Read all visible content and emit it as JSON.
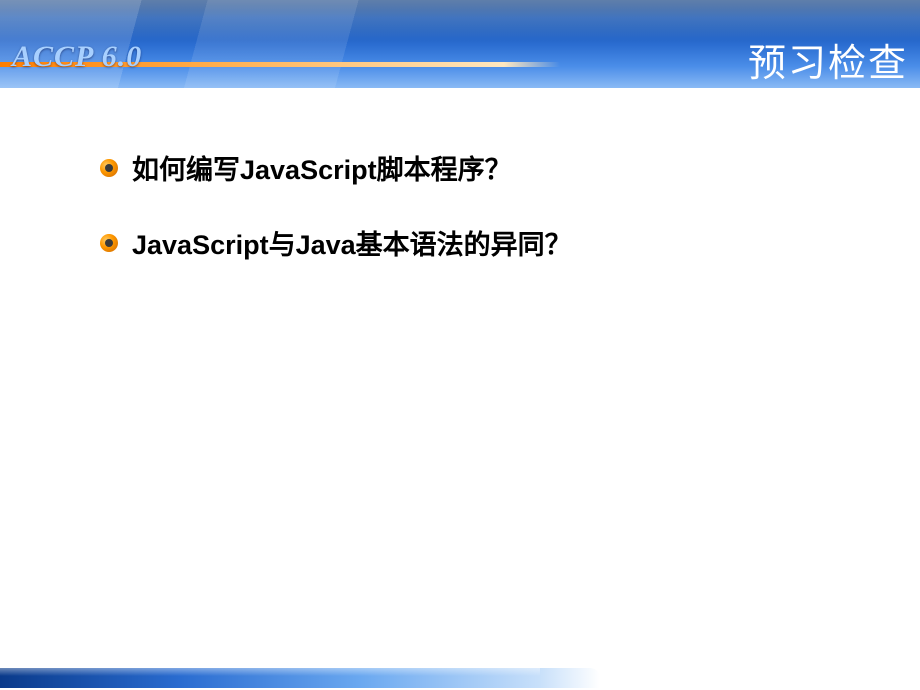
{
  "header": {
    "brand": "ACCP 6.0",
    "title": "预习检查"
  },
  "bullets": [
    {
      "text": "如何编写JavaScript脚本程序？"
    },
    {
      "text": "JavaScript与Java基本语法的异同？"
    }
  ]
}
